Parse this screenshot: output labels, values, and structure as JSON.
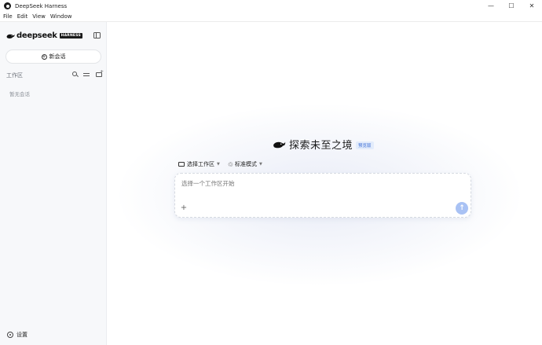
{
  "window": {
    "title": "DeepSeek Harness",
    "controls": {
      "minimize": "—",
      "maximize": "☐",
      "close": "✕"
    }
  },
  "menu": [
    "File",
    "Edit",
    "View",
    "Window"
  ],
  "sidebar": {
    "brand": "deepseek",
    "badge": "HARNESS",
    "new_chat_label": "新会话",
    "workspace_label": "工作区",
    "empty_text": "暂无会话",
    "settings_label": "设置"
  },
  "main": {
    "hero_title": "探索未至之境",
    "preview_badge": "预览版",
    "workspace_select": "选择工作区",
    "mode_select": "标准模式",
    "input_placeholder": "选择一个工作区开始",
    "attach_icon": "+",
    "send_icon": "↑"
  },
  "colors": {
    "accent": "#a9c2f4",
    "badge_blue": "#3d6fd6",
    "sidebar_bg": "#f7f8fa"
  }
}
